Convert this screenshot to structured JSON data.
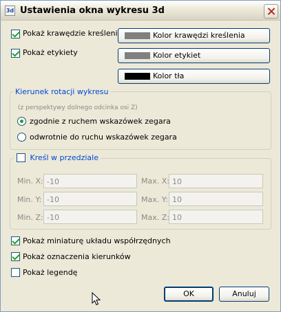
{
  "window": {
    "title": "Ustawienia okna wykresu 3d",
    "icon_text": "3d"
  },
  "options_top": {
    "show_edges": {
      "label": "Pokaż krawędzie kreślenia",
      "checked": true
    },
    "show_labels": {
      "label": "Pokaż etykiety",
      "checked": true
    }
  },
  "color_buttons": {
    "edge_color": {
      "label": "Kolor krawędzi kreślenia",
      "swatch": "#808080"
    },
    "label_color": {
      "label": "Kolor etykiet",
      "swatch": "#808080"
    },
    "background_color": {
      "label": "Kolor tła",
      "swatch": "#000000"
    }
  },
  "rotation": {
    "legend": "Kierunek rotacji wykresu",
    "hint": "(z perspektywy dolnego odcinka osi Z)",
    "clockwise": {
      "label": "zgodnie z ruchem wskazówek zegara",
      "selected": true
    },
    "counterclockwise": {
      "label": "odwrotnie do ruchu wskazówek zegara",
      "selected": false
    }
  },
  "range": {
    "legend": "Kreśl w przedziale",
    "enabled": false,
    "min_x": {
      "label": "Min. X:",
      "value": "-10"
    },
    "max_x": {
      "label": "Max. X:",
      "value": "10"
    },
    "min_y": {
      "label": "Min. Y:",
      "value": "-10"
    },
    "max_y": {
      "label": "Max. Y:",
      "value": "10"
    },
    "min_z": {
      "label": "Min. Z:",
      "value": "-10"
    },
    "max_z": {
      "label": "Max. Z:",
      "value": "10"
    }
  },
  "options_bottom": {
    "show_axes_thumbnail": {
      "label": "Pokaż miniaturę układu współrzędnych",
      "checked": true
    },
    "show_direction_marks": {
      "label": "Pokaż oznaczenia kierunków",
      "checked": true
    },
    "show_legend": {
      "label": "Pokaż legendę",
      "checked": false
    }
  },
  "buttons": {
    "ok": "OK",
    "cancel": "Anuluj"
  }
}
